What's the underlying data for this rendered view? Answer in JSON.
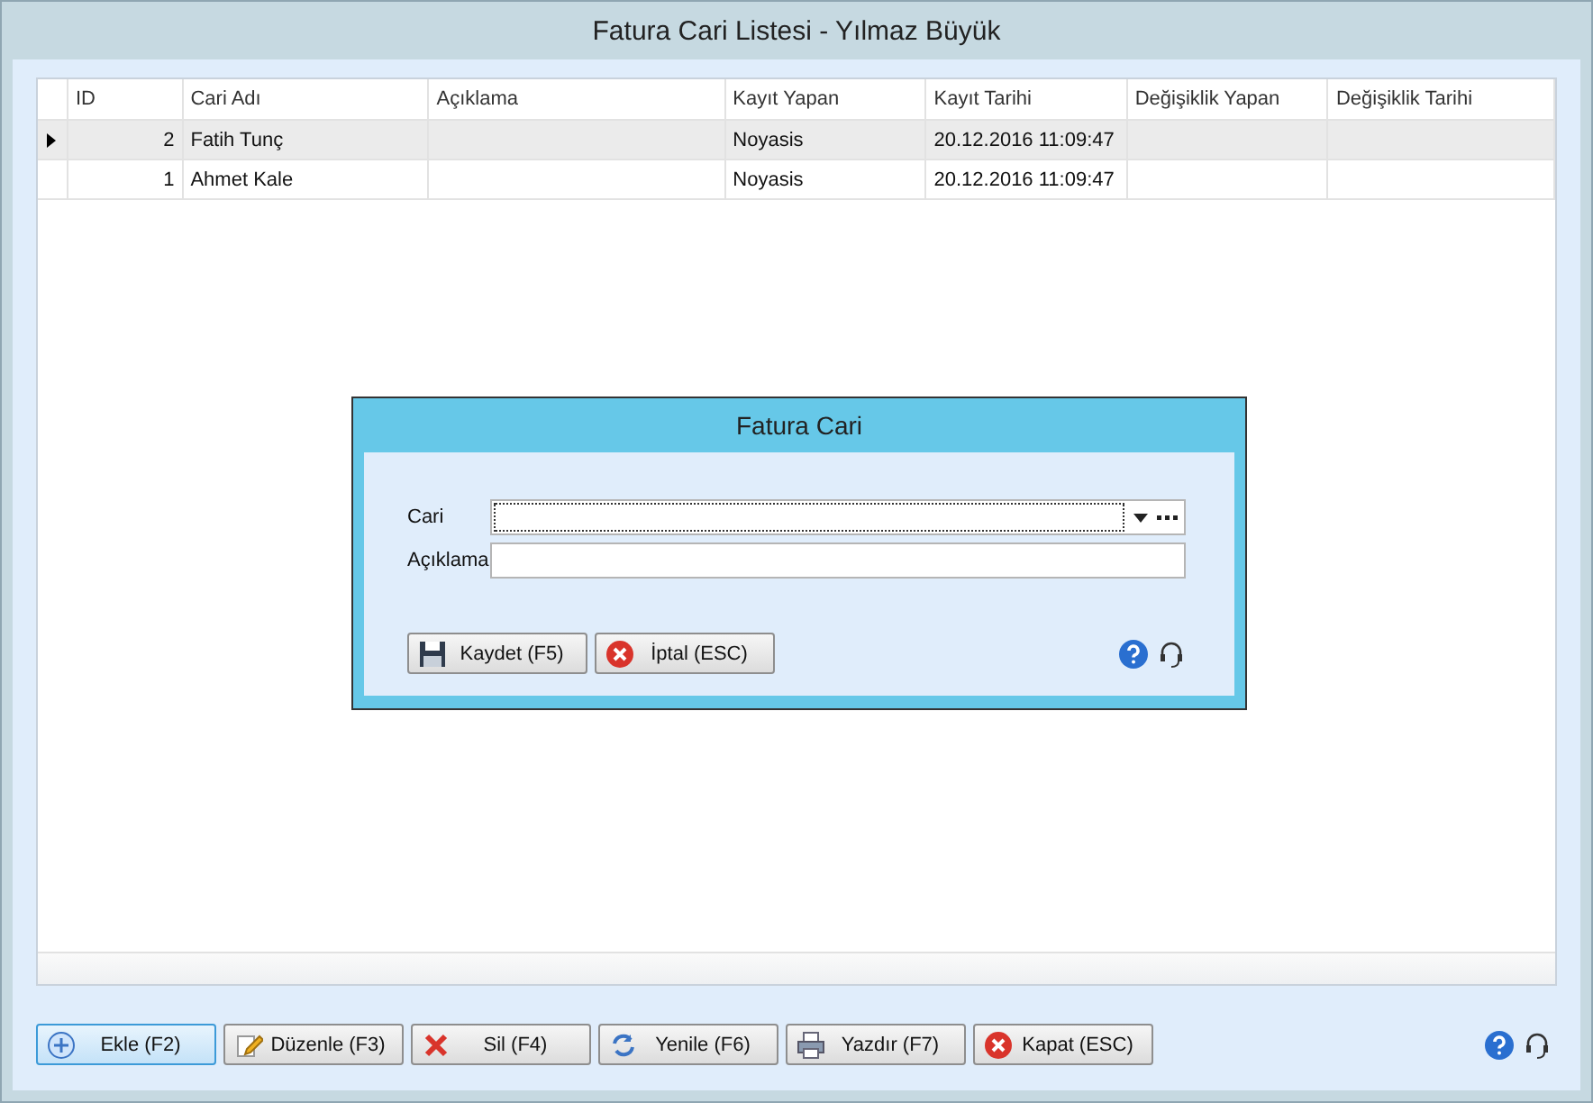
{
  "window": {
    "title": "Fatura Cari Listesi - Yılmaz Büyük"
  },
  "table": {
    "columns": [
      "ID",
      "Cari Adı",
      "Açıklama",
      "Kayıt Yapan",
      "Kayıt Tarihi",
      "Değişiklik Yapan",
      "Değişiklik Tarihi"
    ],
    "rows": [
      {
        "selected": true,
        "cells": [
          "2",
          "Fatih Tunç",
          "",
          "Noyasis",
          "20.12.2016 11:09:47",
          "",
          ""
        ]
      },
      {
        "selected": false,
        "cells": [
          "1",
          "Ahmet Kale",
          "",
          "Noyasis",
          "20.12.2016 11:09:47",
          "",
          ""
        ]
      }
    ]
  },
  "dialog": {
    "title": "Fatura Cari",
    "fields": [
      {
        "label": "Cari",
        "kind": "combo"
      },
      {
        "label": "Açıklama",
        "kind": "text"
      }
    ],
    "buttons": [
      {
        "label": "Kaydet (F5)",
        "kind": "save"
      },
      {
        "label": "İptal (ESC)",
        "kind": "cancel"
      }
    ]
  },
  "buttons": [
    {
      "label": "Ekle (F2)",
      "kind": "add",
      "selected": true
    },
    {
      "label": "Düzenle (F3)",
      "kind": "edit",
      "selected": false
    },
    {
      "label": "Sil (F4)",
      "kind": "delete",
      "selected": false
    },
    {
      "label": "Yenile (F6)",
      "kind": "refresh",
      "selected": false
    },
    {
      "label": "Yazdır (F7)",
      "kind": "print",
      "selected": false
    },
    {
      "label": "Kapat (ESC)",
      "kind": "close",
      "selected": false
    }
  ]
}
